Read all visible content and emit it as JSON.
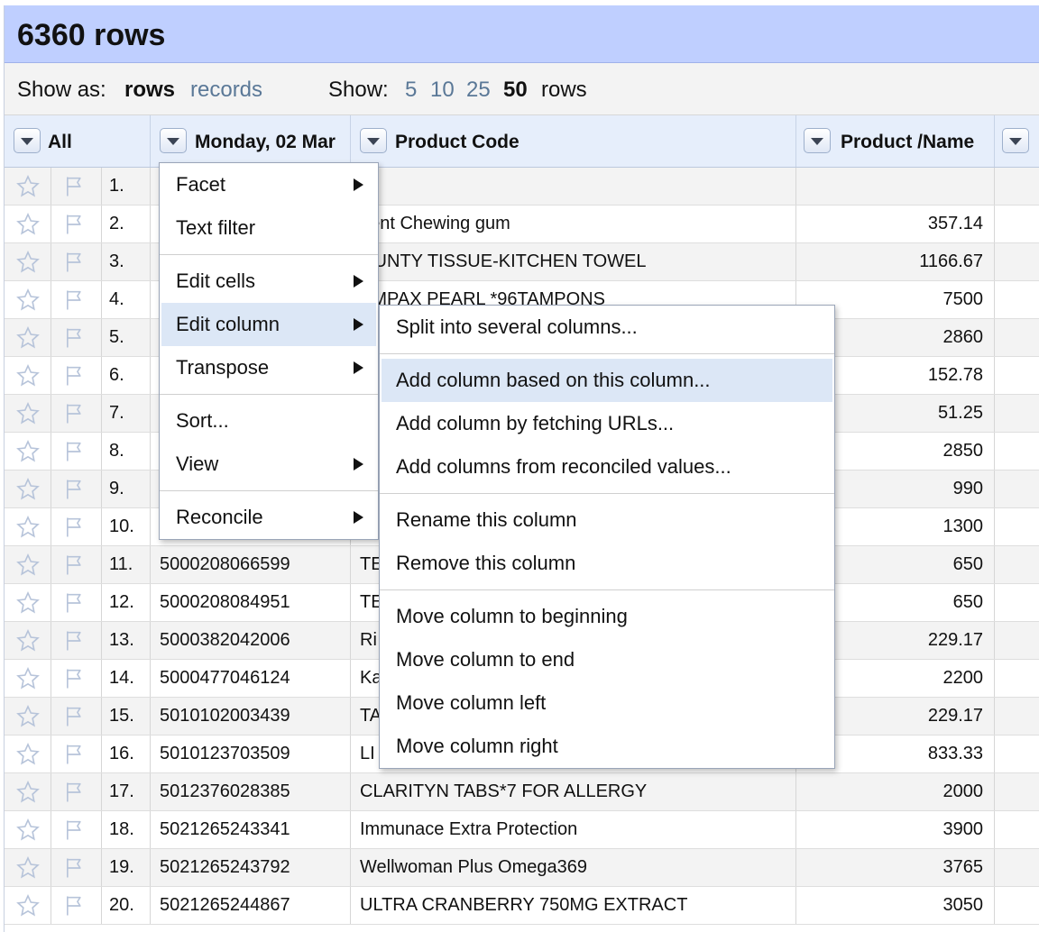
{
  "summary": {
    "row_count": "6360 rows"
  },
  "viewbar": {
    "show_as_label": "Show as:",
    "rows_mode": "rows",
    "records_mode": "records",
    "show_label": "Show:",
    "page_sizes": [
      "5",
      "10",
      "25",
      "50"
    ],
    "page_size_selected": "50",
    "rows_suffix": "rows"
  },
  "columns": {
    "all": "All",
    "date": "Monday, 02 Mar",
    "code": "Product Code",
    "name": "Product /Name"
  },
  "rows": [
    {
      "idx": "1.",
      "date": "",
      "code": "",
      "value": ""
    },
    {
      "idx": "2.",
      "date": "",
      "code": "dent Chewing gum",
      "value": "357.14"
    },
    {
      "idx": "3.",
      "date": "",
      "code": "OUNTY TISSUE-KITCHEN TOWEL",
      "value": "1166.67"
    },
    {
      "idx": "4.",
      "date": "",
      "code": "AMPAX PEARL *96TAMPONS",
      "value": "7500"
    },
    {
      "idx": "5.",
      "date": "",
      "code": "",
      "value": "2860"
    },
    {
      "idx": "6.",
      "date": "",
      "code": "",
      "value": "152.78"
    },
    {
      "idx": "7.",
      "date": "",
      "code": "",
      "value": "51.25"
    },
    {
      "idx": "8.",
      "date": "",
      "code": "",
      "value": "2850"
    },
    {
      "idx": "9.",
      "date": "",
      "code": "",
      "value": "990"
    },
    {
      "idx": "10.",
      "date": "",
      "code": "",
      "value": "1300"
    },
    {
      "idx": "11.",
      "date": "5000208066599",
      "code": "TE",
      "value": "650"
    },
    {
      "idx": "12.",
      "date": "5000208084951",
      "code": "TE",
      "value": "650"
    },
    {
      "idx": "13.",
      "date": "5000382042006",
      "code": "Ri",
      "value": "229.17"
    },
    {
      "idx": "14.",
      "date": "5000477046124",
      "code": "Ka",
      "value": "2200"
    },
    {
      "idx": "15.",
      "date": "5010102003439",
      "code": "TA",
      "value": "229.17"
    },
    {
      "idx": "16.",
      "date": "5010123703509",
      "code": "LI",
      "value": "833.33"
    },
    {
      "idx": "17.",
      "date": "5012376028385",
      "code": "CLARITYN TABS*7 FOR ALLERGY",
      "value": "2000"
    },
    {
      "idx": "18.",
      "date": "5021265243341",
      "code": "Immunace Extra Protection",
      "value": "3900"
    },
    {
      "idx": "19.",
      "date": "5021265243792",
      "code": "Wellwoman Plus Omega369",
      "value": "3765"
    },
    {
      "idx": "20.",
      "date": "5021265244867",
      "code": "ULTRA CRANBERRY 750MG EXTRACT",
      "value": "3050"
    }
  ],
  "column_menu": {
    "facet": "Facet",
    "text_filter": "Text filter",
    "edit_cells": "Edit cells",
    "edit_column": "Edit column",
    "transpose": "Transpose",
    "sort": "Sort...",
    "view": "View",
    "reconcile": "Reconcile"
  },
  "edit_column_menu": {
    "split": "Split into several columns...",
    "add_based": "Add column based on this column...",
    "add_fetch": "Add column by fetching URLs...",
    "add_reconciled": "Add columns from reconciled values...",
    "rename": "Rename this column",
    "remove": "Remove this column",
    "move_beginning": "Move column to beginning",
    "move_end": "Move column to end",
    "move_left": "Move column left",
    "move_right": "Move column right"
  },
  "colors": {
    "header_bg": "#bfcfff",
    "link": "#5a7897",
    "highlight": "#dce7f6"
  },
  "icons": {
    "star": "star-icon",
    "flag": "flag-icon",
    "dropdown": "dropdown-triangle-icon",
    "submenu": "submenu-arrow-icon"
  }
}
